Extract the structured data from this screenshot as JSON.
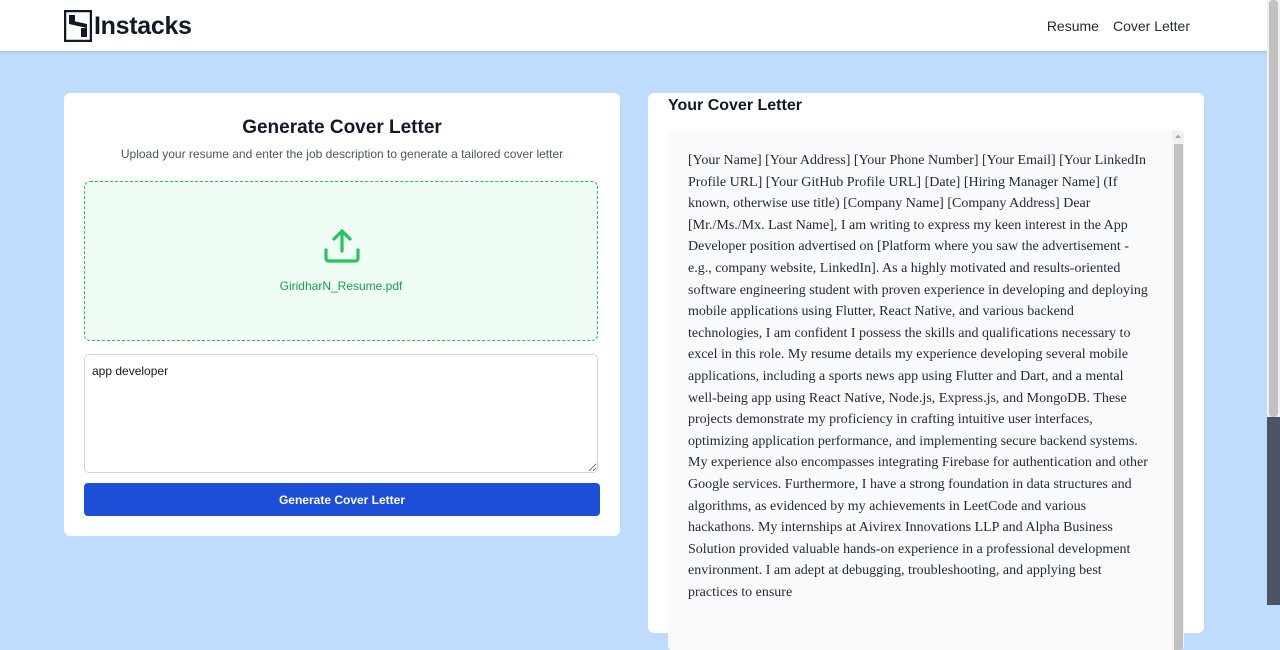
{
  "navbar": {
    "brand": "Instacks",
    "links": [
      "Resume",
      "Cover Letter"
    ]
  },
  "left_panel": {
    "title": "Generate Cover Letter",
    "subtitle": "Upload your resume and enter the job description to generate a tailored cover letter",
    "upload": {
      "icon": "upload-icon",
      "file_name": "GiridharN_Resume.pdf"
    },
    "job_description": {
      "value": "app developer"
    },
    "button_label": "Generate Cover Letter"
  },
  "right_panel": {
    "title": "Your Cover Letter",
    "letter_text": "[Your Name] [Your Address] [Your Phone Number] [Your Email] [Your LinkedIn Profile URL] [Your GitHub Profile URL] [Date] [Hiring Manager Name] (If known, otherwise use title) [Company Name] [Company Address] Dear [Mr./Ms./Mx. Last Name], I am writing to express my keen interest in the App Developer position advertised on [Platform where you saw the advertisement - e.g., company website, LinkedIn]. As a highly motivated and results-oriented software engineering student with proven experience in developing and deploying mobile applications using Flutter, React Native, and various backend technologies, I am confident I possess the skills and qualifications necessary to excel in this role. My resume details my experience developing several mobile applications, including a sports news app using Flutter and Dart, and a mental well-being app using React Native, Node.js, Express.js, and MongoDB. These projects demonstrate my proficiency in crafting intuitive user interfaces, optimizing application performance, and implementing secure backend systems. My experience also encompasses integrating Firebase for authentication and other Google services. Furthermore, I have a strong foundation in data structures and algorithms, as evidenced by my achievements in LeetCode and various hackathons. My internships at Aivirex Innovations LLP and Alpha Business Solution provided valuable hands-on experience in a professional development environment. I am adept at debugging, troubleshooting, and applying best practices to ensure"
  },
  "colors": {
    "background": "#bfdbfe",
    "primary_button": "#1d4ed8",
    "upload_accent": "#22c55e",
    "upload_bg": "#f0fdf4"
  }
}
